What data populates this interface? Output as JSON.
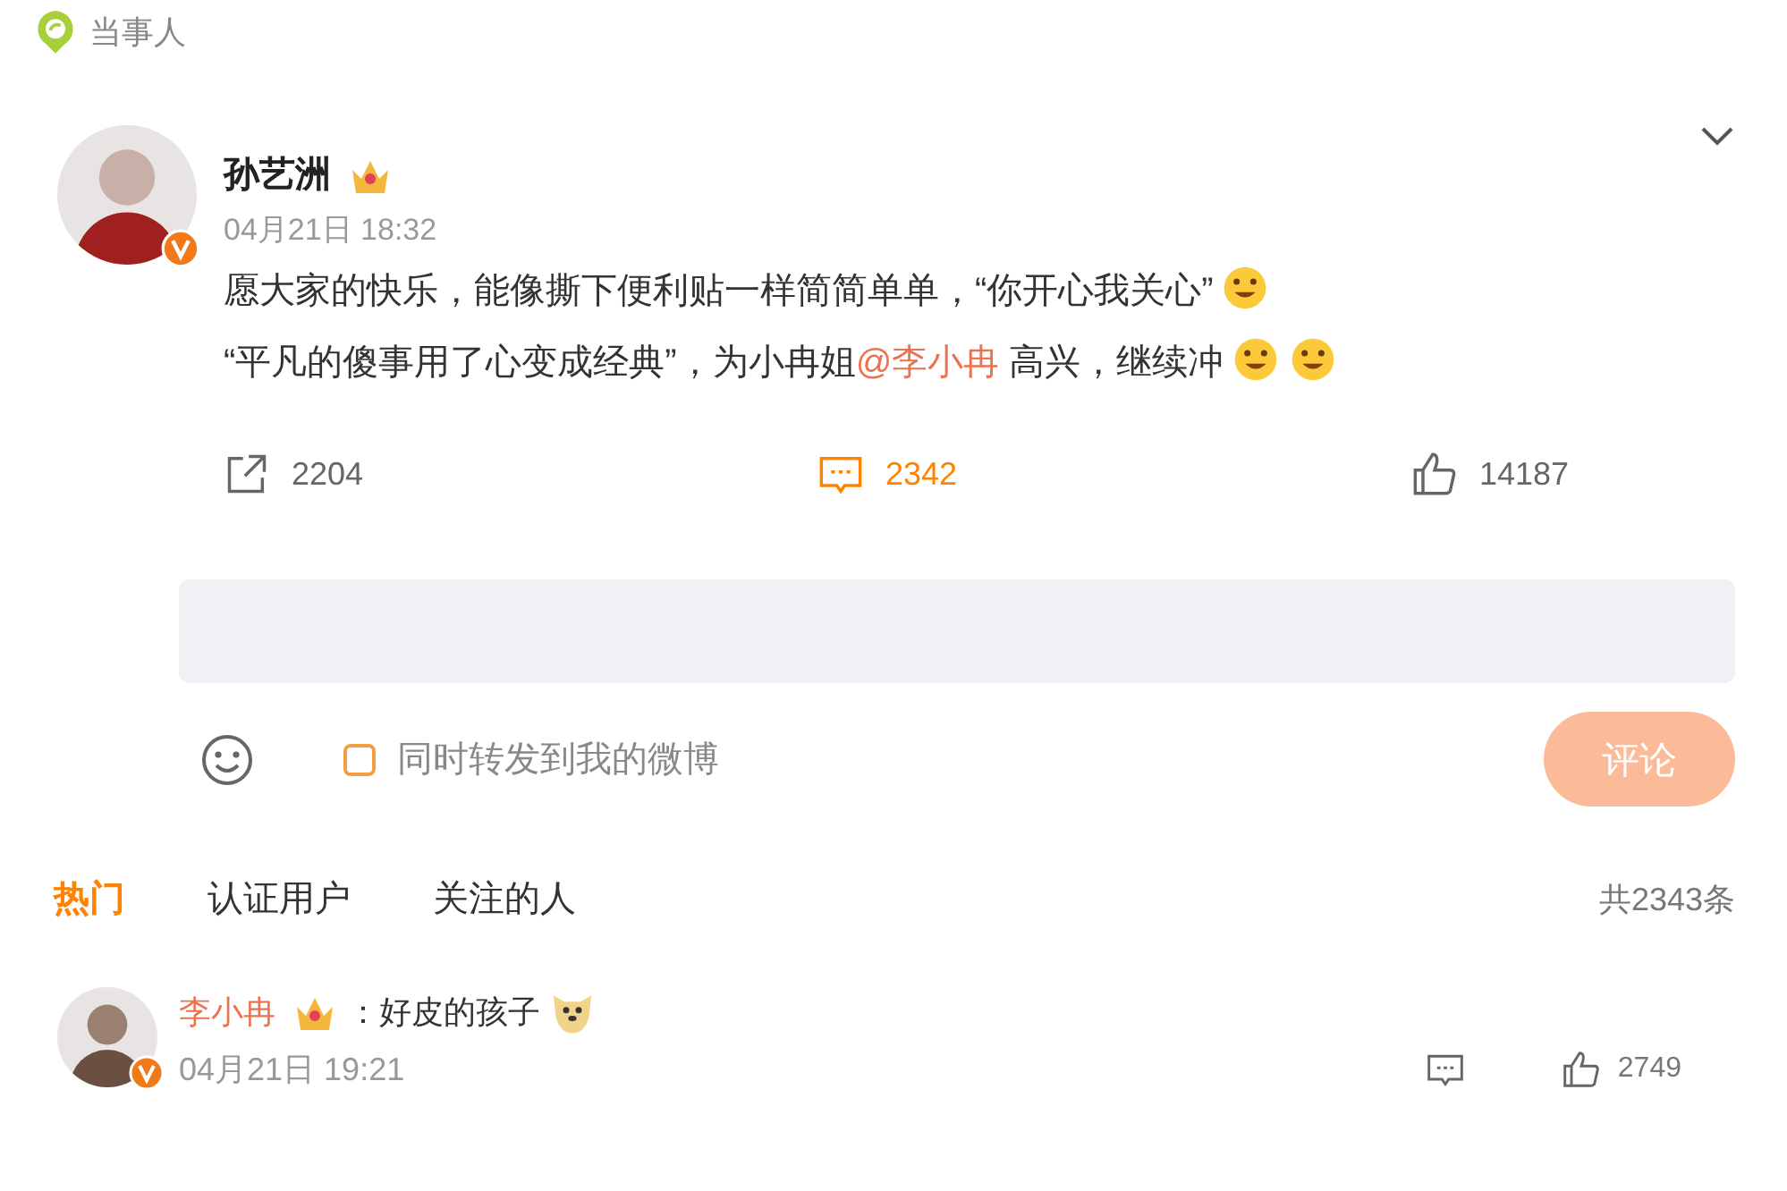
{
  "header": {
    "label": "当事人"
  },
  "post": {
    "author": "孙艺洲",
    "time": "04月21日 18:32",
    "lines": [
      [
        {
          "kind": "text",
          "text": "愿大家的快乐，能像撕下便利贴一样简简单单，“你开心我关心”"
        },
        {
          "kind": "emoji"
        }
      ],
      [
        {
          "kind": "text",
          "text": "“平凡的傻事用了心变成经典”，为小冉姐"
        },
        {
          "kind": "mention",
          "text": "@李小冉"
        },
        {
          "kind": "text",
          "text": " 高兴，继续冲"
        },
        {
          "kind": "emoji"
        },
        {
          "kind": "emoji"
        }
      ]
    ],
    "actions": [
      {
        "kind": "repost",
        "count": "2204",
        "selected": false
      },
      {
        "kind": "comment",
        "count": "2342",
        "selected": true
      },
      {
        "kind": "like",
        "count": "14187",
        "selected": false
      }
    ]
  },
  "composer": {
    "repost_option": {
      "label": "同时转发到我的微博",
      "checked": false
    },
    "submit": {
      "label": "评论",
      "disabled": true
    }
  },
  "tabs": [
    {
      "label": "热门",
      "selected": true
    },
    {
      "label": "认证用户",
      "selected": false
    },
    {
      "label": "关注的人",
      "selected": false
    }
  ],
  "total": "共2343条",
  "comments": [
    {
      "author": "李小冉",
      "text": "：好皮的孩子",
      "time": "04月21日 19:21",
      "likes": "2749"
    }
  ]
}
